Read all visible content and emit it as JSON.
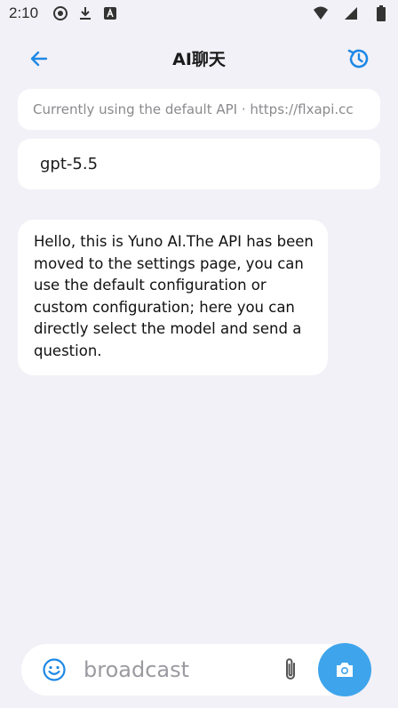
{
  "status_bar": {
    "time": "2:10",
    "left_icons": [
      "record-icon",
      "download-icon",
      "app-a-icon"
    ],
    "right_icons": [
      "wifi-icon",
      "signal-icon",
      "battery-icon"
    ]
  },
  "app_bar": {
    "title": "AI聊天",
    "back_icon": "arrow-left-icon",
    "history_icon": "history-icon",
    "accent_color": "#1e88e5"
  },
  "api_info": "Currently using the default API · https://flxapi.cc",
  "model": "gpt-5.5",
  "messages": [
    {
      "role": "assistant",
      "text": "Hello, this is Yuno AI.The API has been moved to the settings page, you can use the default configuration or custom configuration; here you can directly select the model and send a question."
    }
  ],
  "composer": {
    "placeholder": "broadcast",
    "emoji_icon": "emoji-icon",
    "attach_icon": "paperclip-icon",
    "camera_icon": "camera-icon",
    "camera_color": "#3ea4ec"
  }
}
